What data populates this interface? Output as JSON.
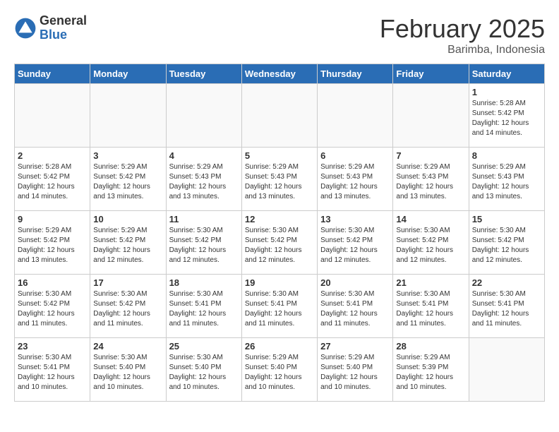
{
  "logo": {
    "general": "General",
    "blue": "Blue"
  },
  "header": {
    "month": "February 2025",
    "location": "Barimba, Indonesia"
  },
  "days_of_week": [
    "Sunday",
    "Monday",
    "Tuesday",
    "Wednesday",
    "Thursday",
    "Friday",
    "Saturday"
  ],
  "weeks": [
    [
      {
        "day": "",
        "detail": ""
      },
      {
        "day": "",
        "detail": ""
      },
      {
        "day": "",
        "detail": ""
      },
      {
        "day": "",
        "detail": ""
      },
      {
        "day": "",
        "detail": ""
      },
      {
        "day": "",
        "detail": ""
      },
      {
        "day": "1",
        "detail": "Sunrise: 5:28 AM\nSunset: 5:42 PM\nDaylight: 12 hours\nand 14 minutes."
      }
    ],
    [
      {
        "day": "2",
        "detail": "Sunrise: 5:28 AM\nSunset: 5:42 PM\nDaylight: 12 hours\nand 14 minutes."
      },
      {
        "day": "3",
        "detail": "Sunrise: 5:29 AM\nSunset: 5:42 PM\nDaylight: 12 hours\nand 13 minutes."
      },
      {
        "day": "4",
        "detail": "Sunrise: 5:29 AM\nSunset: 5:43 PM\nDaylight: 12 hours\nand 13 minutes."
      },
      {
        "day": "5",
        "detail": "Sunrise: 5:29 AM\nSunset: 5:43 PM\nDaylight: 12 hours\nand 13 minutes."
      },
      {
        "day": "6",
        "detail": "Sunrise: 5:29 AM\nSunset: 5:43 PM\nDaylight: 12 hours\nand 13 minutes."
      },
      {
        "day": "7",
        "detail": "Sunrise: 5:29 AM\nSunset: 5:43 PM\nDaylight: 12 hours\nand 13 minutes."
      },
      {
        "day": "8",
        "detail": "Sunrise: 5:29 AM\nSunset: 5:43 PM\nDaylight: 12 hours\nand 13 minutes."
      }
    ],
    [
      {
        "day": "9",
        "detail": "Sunrise: 5:29 AM\nSunset: 5:42 PM\nDaylight: 12 hours\nand 13 minutes."
      },
      {
        "day": "10",
        "detail": "Sunrise: 5:29 AM\nSunset: 5:42 PM\nDaylight: 12 hours\nand 12 minutes."
      },
      {
        "day": "11",
        "detail": "Sunrise: 5:30 AM\nSunset: 5:42 PM\nDaylight: 12 hours\nand 12 minutes."
      },
      {
        "day": "12",
        "detail": "Sunrise: 5:30 AM\nSunset: 5:42 PM\nDaylight: 12 hours\nand 12 minutes."
      },
      {
        "day": "13",
        "detail": "Sunrise: 5:30 AM\nSunset: 5:42 PM\nDaylight: 12 hours\nand 12 minutes."
      },
      {
        "day": "14",
        "detail": "Sunrise: 5:30 AM\nSunset: 5:42 PM\nDaylight: 12 hours\nand 12 minutes."
      },
      {
        "day": "15",
        "detail": "Sunrise: 5:30 AM\nSunset: 5:42 PM\nDaylight: 12 hours\nand 12 minutes."
      }
    ],
    [
      {
        "day": "16",
        "detail": "Sunrise: 5:30 AM\nSunset: 5:42 PM\nDaylight: 12 hours\nand 11 minutes."
      },
      {
        "day": "17",
        "detail": "Sunrise: 5:30 AM\nSunset: 5:42 PM\nDaylight: 12 hours\nand 11 minutes."
      },
      {
        "day": "18",
        "detail": "Sunrise: 5:30 AM\nSunset: 5:41 PM\nDaylight: 12 hours\nand 11 minutes."
      },
      {
        "day": "19",
        "detail": "Sunrise: 5:30 AM\nSunset: 5:41 PM\nDaylight: 12 hours\nand 11 minutes."
      },
      {
        "day": "20",
        "detail": "Sunrise: 5:30 AM\nSunset: 5:41 PM\nDaylight: 12 hours\nand 11 minutes."
      },
      {
        "day": "21",
        "detail": "Sunrise: 5:30 AM\nSunset: 5:41 PM\nDaylight: 12 hours\nand 11 minutes."
      },
      {
        "day": "22",
        "detail": "Sunrise: 5:30 AM\nSunset: 5:41 PM\nDaylight: 12 hours\nand 11 minutes."
      }
    ],
    [
      {
        "day": "23",
        "detail": "Sunrise: 5:30 AM\nSunset: 5:41 PM\nDaylight: 12 hours\nand 10 minutes."
      },
      {
        "day": "24",
        "detail": "Sunrise: 5:30 AM\nSunset: 5:40 PM\nDaylight: 12 hours\nand 10 minutes."
      },
      {
        "day": "25",
        "detail": "Sunrise: 5:30 AM\nSunset: 5:40 PM\nDaylight: 12 hours\nand 10 minutes."
      },
      {
        "day": "26",
        "detail": "Sunrise: 5:29 AM\nSunset: 5:40 PM\nDaylight: 12 hours\nand 10 minutes."
      },
      {
        "day": "27",
        "detail": "Sunrise: 5:29 AM\nSunset: 5:40 PM\nDaylight: 12 hours\nand 10 minutes."
      },
      {
        "day": "28",
        "detail": "Sunrise: 5:29 AM\nSunset: 5:39 PM\nDaylight: 12 hours\nand 10 minutes."
      },
      {
        "day": "",
        "detail": ""
      }
    ]
  ]
}
